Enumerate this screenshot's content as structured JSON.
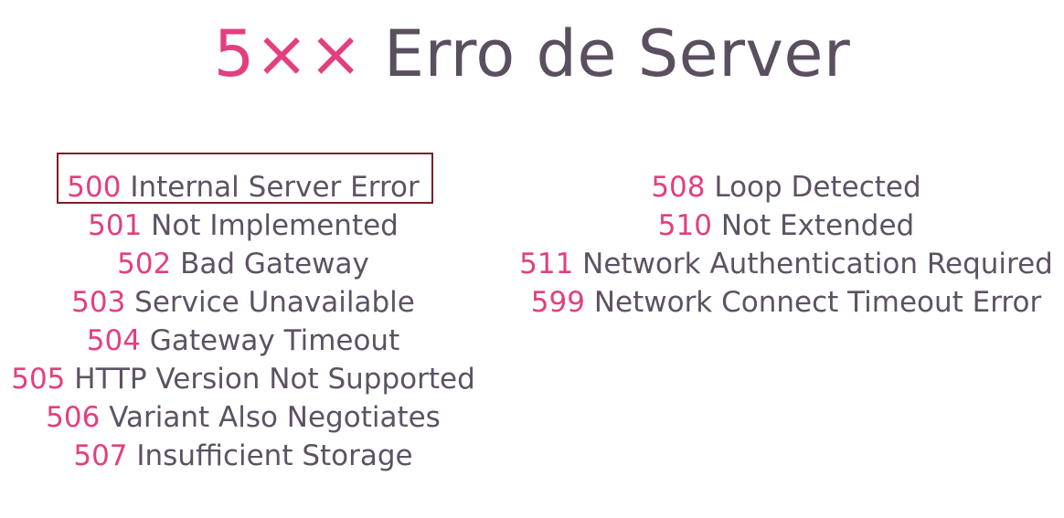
{
  "title": {
    "code": "5××",
    "text": "Erro de Server"
  },
  "colors": {
    "accent": "#e23f7f",
    "text": "#5d5263",
    "highlight_border": "#7a1f28"
  },
  "left_list": [
    {
      "code": "500",
      "label": "Internal Server Error"
    },
    {
      "code": "501",
      "label": "Not Implemented"
    },
    {
      "code": "502",
      "label": "Bad Gateway"
    },
    {
      "code": "503",
      "label": "Service Unavailable"
    },
    {
      "code": "504",
      "label": "Gateway Timeout"
    },
    {
      "code": "505",
      "label": "HTTP Version Not Supported"
    },
    {
      "code": "506",
      "label": "Variant Also Negotiates"
    },
    {
      "code": "507",
      "label": "Insufficient Storage"
    }
  ],
  "right_list": [
    {
      "code": "508",
      "label": "Loop Detected"
    },
    {
      "code": "510",
      "label": "Not Extended"
    },
    {
      "code": "511",
      "label": "Network Authentication Required"
    },
    {
      "code": "599",
      "label": "Network Connect Timeout Error"
    }
  ]
}
